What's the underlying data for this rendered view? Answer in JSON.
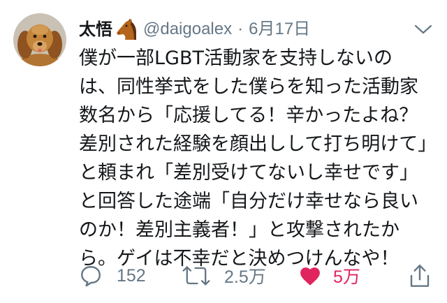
{
  "tweet": {
    "author": {
      "avatar_icon": "dog-photo-avatar",
      "display_name": "太悟",
      "name_emoji_icon": "horse-face-icon",
      "handle": "@daigoalex",
      "separator": "·",
      "date": "6月17日"
    },
    "menu_icon": "chevron-down-icon",
    "text_lines": [
      "僕が一部LGBT活動家を支持しないの",
      "は、同性挙式をした僕らを知った活動家",
      "数名から「応援してる！辛かったよね？",
      "差別された経験を顔出しして打ち明けて」",
      "と頼まれ「差別受けてないし幸せです」",
      "と回答した途端「自分だけ幸せなら良い",
      "のか！差別主義者！」と攻撃されたか",
      "ら。ゲイは不幸だと決めつけんなや！"
    ],
    "actions": {
      "reply": {
        "icon": "reply-icon",
        "count": "152"
      },
      "retweet": {
        "icon": "retweet-icon",
        "count": "2.5万"
      },
      "like": {
        "icon": "heart-filled-icon",
        "count": "5万",
        "liked": true
      },
      "share": {
        "icon": "share-icon"
      }
    }
  },
  "colors": {
    "text": "#14171a",
    "secondary": "#657786",
    "like": "#e0245e",
    "background": "#ffffff"
  }
}
